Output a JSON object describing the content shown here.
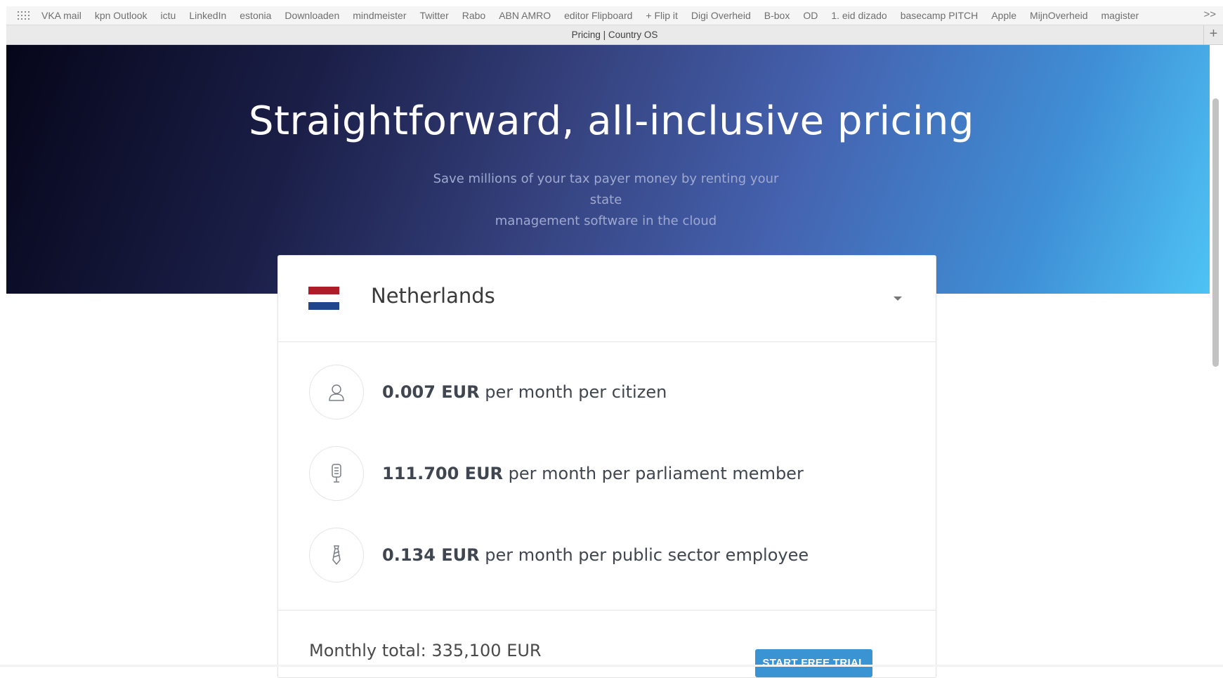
{
  "bookmarks": [
    "VKA mail",
    "kpn Outlook",
    "ictu",
    "LinkedIn",
    "estonia",
    "Downloaden",
    "mindmeister",
    "Twitter",
    "Rabo",
    "ABN AMRO",
    "editor Flipboard",
    "+ Flip it",
    "Digi Overheid",
    "B-box",
    "OD",
    "1. eid dizado",
    "basecamp PITCH",
    "Apple",
    "MijnOverheid",
    "magister"
  ],
  "bookmarks_overflow": ">>",
  "tab": {
    "title": "Pricing | Country OS",
    "new_tab": "+"
  },
  "hero": {
    "title": "Straightforward, all-inclusive pricing",
    "subtitle_line1": "Save millions of your tax payer money by renting your state",
    "subtitle_line2": "management software in the cloud"
  },
  "pricing": {
    "country": "Netherlands",
    "rows": [
      {
        "icon": "person-icon",
        "amount": "0.007 EUR",
        "desc": " per month per citizen"
      },
      {
        "icon": "microphone-icon",
        "amount": "111.700 EUR",
        "desc": " per month per parliament member"
      },
      {
        "icon": "tie-icon",
        "amount": "0.134 EUR",
        "desc": " per month per public sector employee"
      }
    ],
    "monthly_total": "Monthly total: 335,100 EUR",
    "cta": "START FREE TRIAL"
  },
  "colors": {
    "accent": "#3a93d3",
    "flag_red": "#ae1c28",
    "flag_white": "#ffffff",
    "flag_blue": "#21468b"
  }
}
